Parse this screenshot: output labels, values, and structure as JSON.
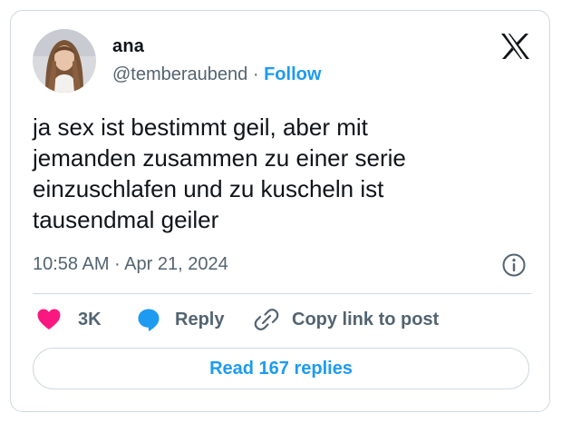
{
  "author": {
    "name": "ana",
    "handle": "@temberaubend",
    "separator": "·",
    "follow_label": "Follow"
  },
  "tweet": {
    "text": "ja sex ist bestimmt geil, aber mit\njemanden zusammen zu einer serie\neinzuschlafen und zu kuscheln ist\ntausendmal geiler",
    "timestamp": "10:58 AM · Apr 21, 2024"
  },
  "actions": {
    "like_count": "3K",
    "reply_label": "Reply",
    "copy_label": "Copy link to post"
  },
  "read_replies_label": "Read 167 replies",
  "colors": {
    "accent": "#1d9bf0",
    "like": "#f91880",
    "muted_text": "#536471",
    "border": "#cfd9de"
  },
  "icons": [
    "x-logo-icon",
    "info-icon",
    "heart-icon",
    "reply-bubble-icon",
    "link-icon"
  ]
}
